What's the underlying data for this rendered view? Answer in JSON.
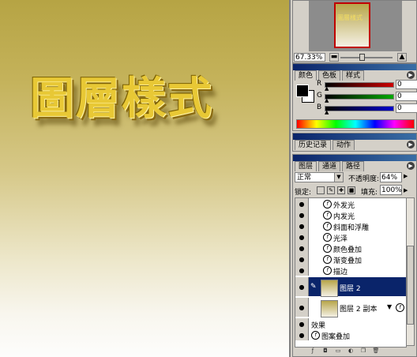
{
  "canvas": {
    "title_text": "圖層樣式"
  },
  "navigator": {
    "thumb_text": "圖層樣式",
    "zoom": "67.33%"
  },
  "color_panel": {
    "tabs": [
      "颜色",
      "色板",
      "样式"
    ],
    "channels": [
      {
        "label": "R",
        "value": "0",
        "color": "#cc0000"
      },
      {
        "label": "G",
        "value": "0",
        "color": "#00aa00"
      },
      {
        "label": "B",
        "value": "0",
        "color": "#0000cc"
      }
    ]
  },
  "history_panel": {
    "tabs": [
      "历史记录",
      "动作"
    ]
  },
  "layers_panel": {
    "tabs": [
      "图层",
      "通道",
      "路径"
    ],
    "blend_mode": "正常",
    "opacity_label": "不透明度:",
    "opacity": "64%",
    "lock_label": "锁定:",
    "fill_label": "填充:",
    "fill": "100%",
    "effects_top": [
      "外发光",
      "内发光",
      "斜面和浮雕",
      "光泽",
      "颜色叠加",
      "渐变叠加",
      "描边"
    ],
    "selected_layer": "图层 2",
    "copy_layer": "图层 2 副本",
    "effects_label": "效果",
    "copy_effects": [
      "图案叠加"
    ]
  }
}
